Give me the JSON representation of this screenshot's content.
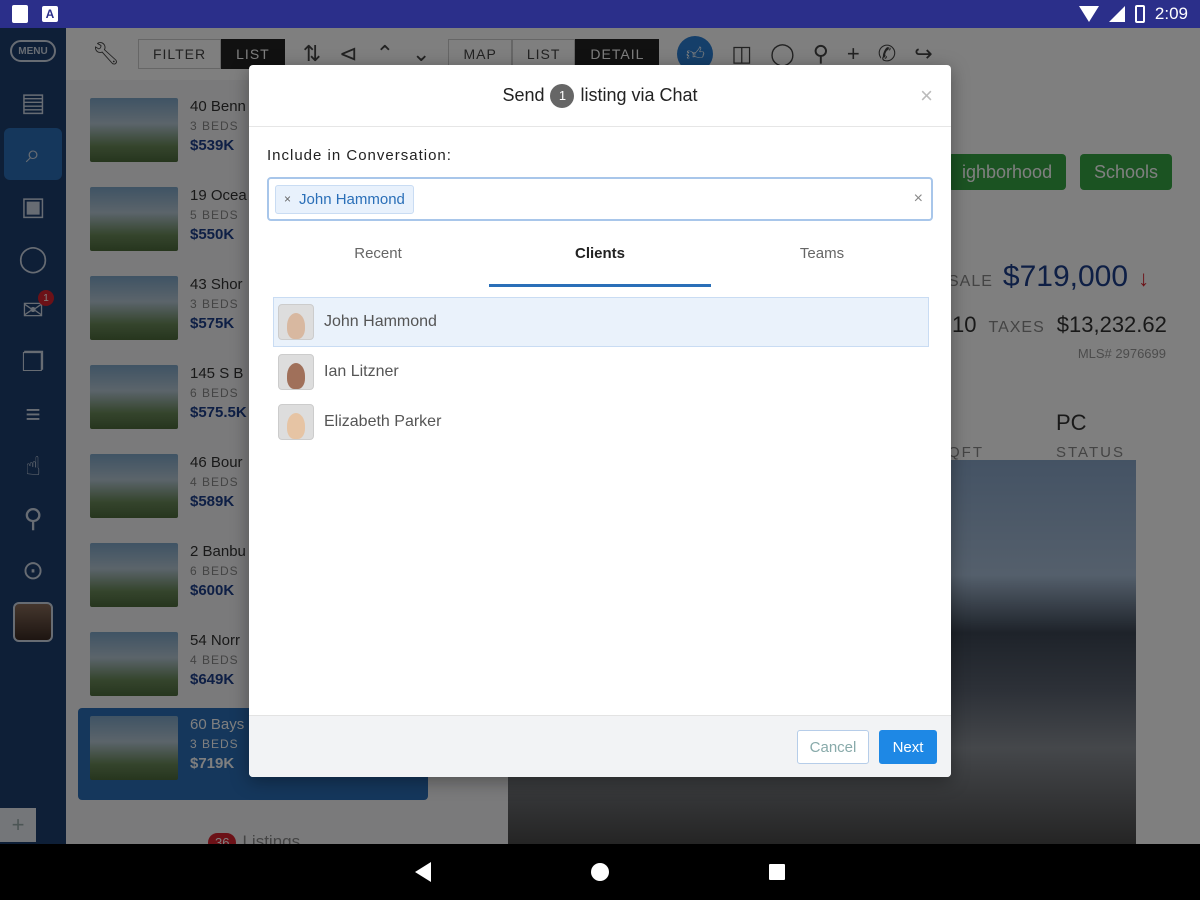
{
  "status_bar": {
    "time": "2:09"
  },
  "left_nav": {
    "menu_label": "MENU",
    "message_badge": "1"
  },
  "toolbar": {
    "filter_label": "FILTER",
    "list_label": "LIST",
    "map_label": "MAP",
    "list2_label": "LIST",
    "detail_label": "DETAIL"
  },
  "listings": [
    {
      "address": "40 Benn",
      "beds": "3 BEDS",
      "price": "$539K"
    },
    {
      "address": "19 Ocea",
      "beds": "5 BEDS",
      "price": "$550K"
    },
    {
      "address": "43 Shor",
      "beds": "3 BEDS",
      "price": "$575K"
    },
    {
      "address": "145 S B",
      "beds": "6 BEDS",
      "price": "$575.5K"
    },
    {
      "address": "46 Bour",
      "beds": "4 BEDS",
      "price": "$589K"
    },
    {
      "address": "2 Banbu",
      "beds": "6 BEDS",
      "price": "$600K"
    },
    {
      "address": "54 Norr",
      "beds": "4 BEDS",
      "price": "$649K"
    },
    {
      "address": "60 Bays",
      "beds": "3 BEDS",
      "price": "$719K"
    }
  ],
  "listings_count": {
    "count": "36",
    "label": "Listings"
  },
  "detail": {
    "neighborhood_label": "ighborhood",
    "schools_label": "Schools",
    "sale_label": "SALE",
    "price": "$719,000",
    "price_arrow": "↓",
    "beds_fragment": "10",
    "taxes_label": "TAXES",
    "taxes_value": "$13,232.62",
    "mls": "MLS# 2976699",
    "sqft_label": "QFT",
    "status_value": "PC",
    "status_label": "STATUS"
  },
  "modal": {
    "title_pre": "Send",
    "title_count": "1",
    "title_post": "listing via Chat",
    "close": "×",
    "include_label": "Include in Conversation:",
    "recipient_chip": "John Hammond",
    "chip_remove": "×",
    "clear": "×",
    "tabs": [
      {
        "label": "Recent"
      },
      {
        "label": "Clients"
      },
      {
        "label": "Teams"
      }
    ],
    "clients": [
      {
        "name": "John Hammond"
      },
      {
        "name": "Ian Litzner"
      },
      {
        "name": "Elizabeth Parker"
      }
    ],
    "cancel_label": "Cancel",
    "next_label": "Next"
  },
  "colors": {
    "nav_bg": "#1d3e6e",
    "accent_blue": "#2a6fb8",
    "next_blue": "#1e88e5",
    "green_chip": "#36a745",
    "badge_red": "#d9232e"
  }
}
